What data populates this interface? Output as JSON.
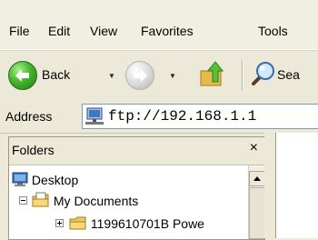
{
  "menu": {
    "items": [
      "File",
      "Edit",
      "View",
      "Favorites",
      "Tools"
    ]
  },
  "toolbar": {
    "back_label": "Back",
    "search_label": "Sea"
  },
  "address": {
    "label": "Address",
    "value": "ftp://192.168.1.1"
  },
  "folders": {
    "title": "Folders",
    "close": "×",
    "tree": [
      "Desktop",
      "My Documents",
      "1199610701B Powe"
    ]
  },
  "icons": {
    "back": "back-arrow-icon",
    "forward": "forward-arrow-icon",
    "up": "up-folder-icon",
    "search": "search-magnifier-icon",
    "ftp": "network-folder-icon",
    "desktop": "desktop-icon",
    "my_documents": "my-documents-icon",
    "folder": "folder-icon"
  },
  "colors": {
    "chrome": "#ece9d8",
    "back_green": "#48b52e",
    "address_border": "#7f9db9"
  }
}
